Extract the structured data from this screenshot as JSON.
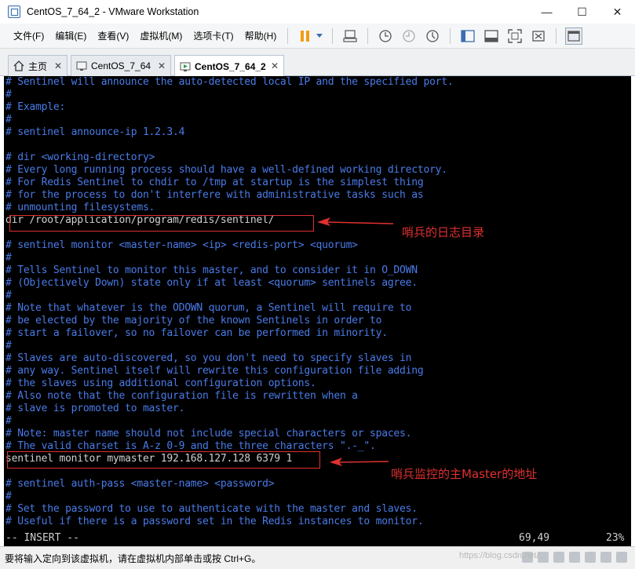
{
  "window": {
    "title": "CentOS_7_64_2 - VMware Workstation",
    "controls": [
      "—",
      "☐",
      "✕"
    ]
  },
  "menu": [
    "文件(F)",
    "编辑(E)",
    "查看(V)",
    "虚拟机(M)",
    "选项卡(T)",
    "帮助(H)"
  ],
  "tabs": [
    {
      "label": "主页"
    },
    {
      "label": "CentOS_7_64"
    },
    {
      "label": "CentOS_7_64_2"
    }
  ],
  "console": {
    "lines": [
      {
        "text": "# Sentinel will announce the auto-detected local IP and the specified port.",
        "color": "blue"
      },
      {
        "text": "#",
        "color": "blue"
      },
      {
        "text": "# Example:",
        "color": "blue"
      },
      {
        "text": "#",
        "color": "blue"
      },
      {
        "text": "# sentinel announce-ip 1.2.3.4",
        "color": "blue"
      },
      {
        "text": "",
        "color": "blue"
      },
      {
        "text": "# dir <working-directory>",
        "color": "blue"
      },
      {
        "text": "# Every long running process should have a well-defined working directory.",
        "color": "blue"
      },
      {
        "text": "# For Redis Sentinel to chdir to /tmp at startup is the simplest thing",
        "color": "blue"
      },
      {
        "text": "# for the process to don't interfere with administrative tasks such as",
        "color": "blue"
      },
      {
        "text": "# unmounting filesystems.",
        "color": "blue"
      },
      {
        "text": "dir /root/application/program/redis/sentinel/",
        "color": "gray"
      },
      {
        "text": "",
        "color": "blue"
      },
      {
        "text": "# sentinel monitor <master-name> <ip> <redis-port> <quorum>",
        "color": "blue"
      },
      {
        "text": "#",
        "color": "blue"
      },
      {
        "text": "# Tells Sentinel to monitor this master, and to consider it in O_DOWN",
        "color": "blue"
      },
      {
        "text": "# (Objectively Down) state only if at least <quorum> sentinels agree.",
        "color": "blue"
      },
      {
        "text": "#",
        "color": "blue"
      },
      {
        "text": "# Note that whatever is the ODOWN quorum, a Sentinel will require to",
        "color": "blue"
      },
      {
        "text": "# be elected by the majority of the known Sentinels in order to",
        "color": "blue"
      },
      {
        "text": "# start a failover, so no failover can be performed in minority.",
        "color": "blue"
      },
      {
        "text": "#",
        "color": "blue"
      },
      {
        "text": "# Slaves are auto-discovered, so you don't need to specify slaves in",
        "color": "blue"
      },
      {
        "text": "# any way. Sentinel itself will rewrite this configuration file adding",
        "color": "blue"
      },
      {
        "text": "# the slaves using additional configuration options.",
        "color": "blue"
      },
      {
        "text": "# Also note that the configuration file is rewritten when a",
        "color": "blue"
      },
      {
        "text": "# slave is promoted to master.",
        "color": "blue"
      },
      {
        "text": "#",
        "color": "blue"
      },
      {
        "text": "# Note: master name should not include special characters or spaces.",
        "color": "blue"
      },
      {
        "text": "# The valid charset is A-z 0-9 and the three characters \".-_\".",
        "color": "blue"
      },
      {
        "text": "sentinel monitor mymaster 192.168.127.128 6379 1",
        "color": "gray"
      },
      {
        "text": "",
        "color": "blue"
      },
      {
        "text": "# sentinel auth-pass <master-name> <password>",
        "color": "blue"
      },
      {
        "text": "#",
        "color": "blue"
      },
      {
        "text": "# Set the password to use to authenticate with the master and slaves.",
        "color": "blue"
      },
      {
        "text": "# Useful if there is a password set in the Redis instances to monitor.",
        "color": "blue"
      }
    ],
    "status": {
      "mode": "-- INSERT --",
      "position": "69,49",
      "percent": "23%"
    }
  },
  "annotations": [
    {
      "label": "哨兵的日志目录"
    },
    {
      "label": "哨兵监控的主Master的地址"
    }
  ],
  "statusbar": {
    "message": "要将输入定向到该虚拟机，请在虚拟机内部单击或按 Ctrl+G。",
    "watermark": "https://blog.csdn.net/..."
  },
  "colors": {
    "comment": "#4a7be8",
    "keyword": "#27d8d8",
    "plain": "#d0d0d0",
    "annotation": "#e03030",
    "console_bg": "#000000"
  }
}
